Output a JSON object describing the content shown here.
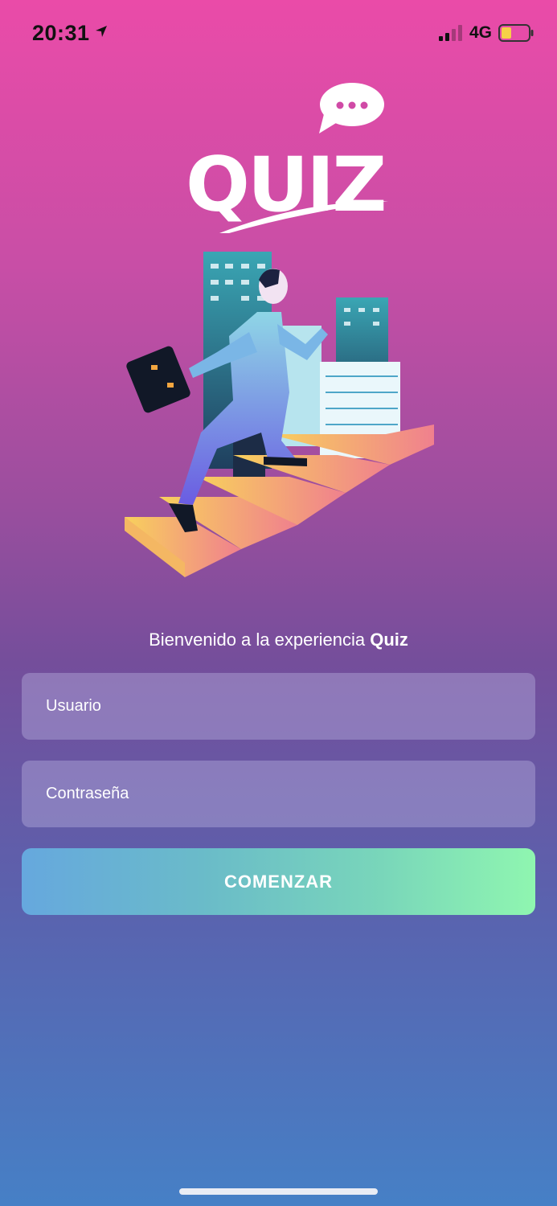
{
  "status_bar": {
    "time": "20:31",
    "network": "4G"
  },
  "logo_text": "QUIZ",
  "welcome": {
    "prefix": "Bienvenido a la experiencia ",
    "brand": "Quiz"
  },
  "form": {
    "username_placeholder": "Usuario",
    "password_placeholder": "Contraseña",
    "submit_label": "COMENZAR"
  },
  "colors": {
    "gradient_top": "#EA4BA8",
    "gradient_bottom": "#4680C6",
    "button_start": "#66A8DE",
    "button_end": "#8FF6B0"
  }
}
